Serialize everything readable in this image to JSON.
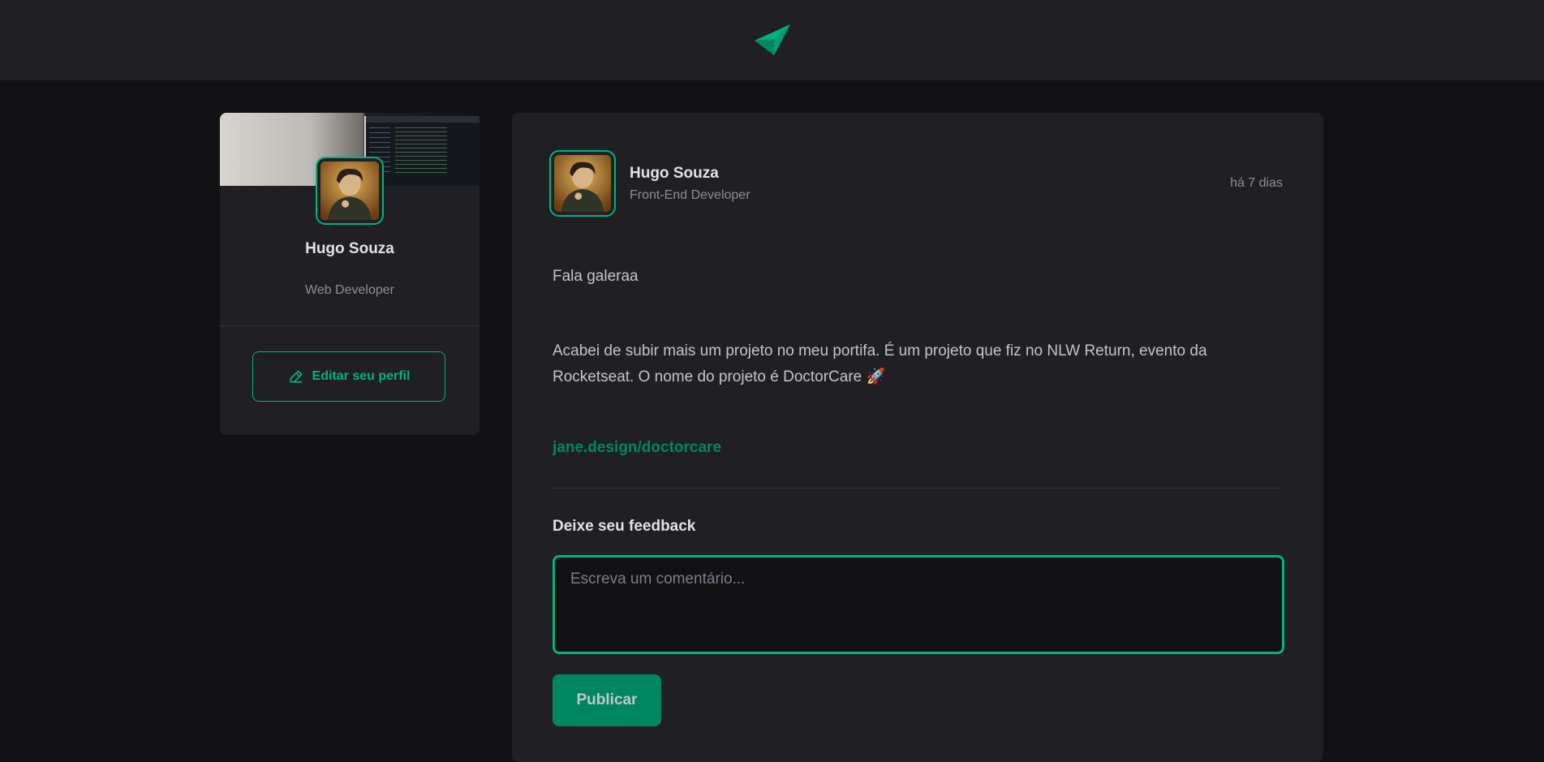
{
  "header": {
    "logo_icon": "ignite-feed-logo-icon"
  },
  "sidebar": {
    "name": "Hugo Souza",
    "role": "Web Developer",
    "edit_label": "Editar seu perfil",
    "edit_icon": "pencil-icon"
  },
  "post": {
    "author": {
      "name": "Hugo Souza",
      "role": "Front-End Developer"
    },
    "published": "há 7 dias",
    "paragraphs": [
      "Fala galeraa",
      "Acabei de subir mais um projeto no meu portifa. É um projeto que fiz no NLW Return, evento da Rocketseat. O nome do projeto é DoctorCare 🚀"
    ],
    "link": "jane.design/doctorcare"
  },
  "feedback": {
    "title": "Deixe seu feedback",
    "placeholder": "Escreva um comentário...",
    "publish_label": "Publicar"
  },
  "colors": {
    "accent": "#00b37e",
    "accent_dark": "#00875f",
    "background": "#121214",
    "surface": "#202024"
  }
}
